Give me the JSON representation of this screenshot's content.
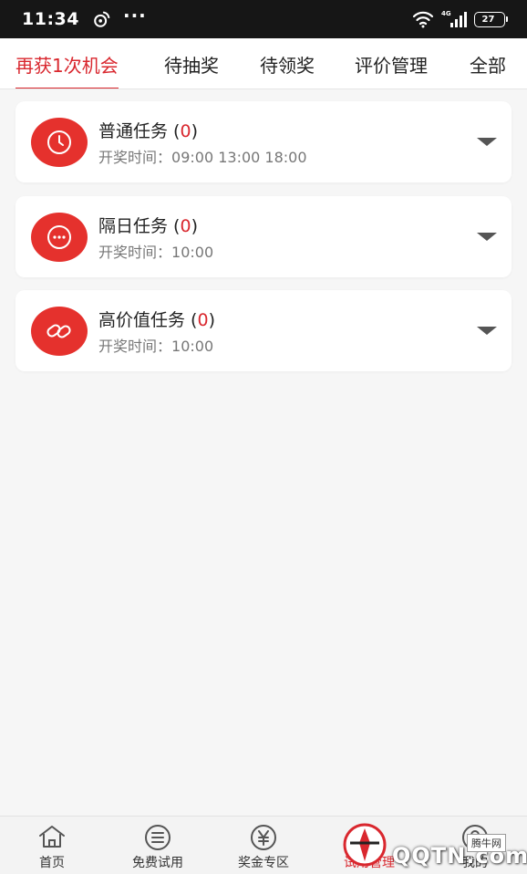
{
  "status_bar": {
    "time": "11:34",
    "dots": "···",
    "network": "4G",
    "battery": "27"
  },
  "tabs": [
    {
      "label": "再获1次机会",
      "active": true
    },
    {
      "label": "待抽奖",
      "active": false
    },
    {
      "label": "待领奖",
      "active": false
    },
    {
      "label": "评价管理",
      "active": false
    },
    {
      "label": "全部",
      "active": false
    }
  ],
  "tasks": [
    {
      "name": "普通任务",
      "count": "0",
      "time_label": "开奖时间：",
      "time_value": "09:00 13:00 18:00",
      "icon": "clock-icon"
    },
    {
      "name": "隔日任务",
      "count": "0",
      "time_label": "开奖时间：",
      "time_value": "10:00",
      "icon": "more-icon"
    },
    {
      "name": "高价值任务",
      "count": "0",
      "time_label": "开奖时间：",
      "time_value": "10:00",
      "icon": "link-icon"
    }
  ],
  "bottom_nav": [
    {
      "label": "首页",
      "icon": "home-icon"
    },
    {
      "label": "免费试用",
      "icon": "list-icon"
    },
    {
      "label": "奖金专区",
      "icon": "yen-icon"
    },
    {
      "label": "试用管理",
      "icon": "manage-icon",
      "active": true
    },
    {
      "label": "我的",
      "icon": "user-icon"
    }
  ],
  "watermark": {
    "text": "QQTN.com",
    "badge": "腾牛网"
  },
  "colors": {
    "accent": "#d9272e",
    "icon_bg": "#e5312d",
    "status_bar": "#161616"
  }
}
